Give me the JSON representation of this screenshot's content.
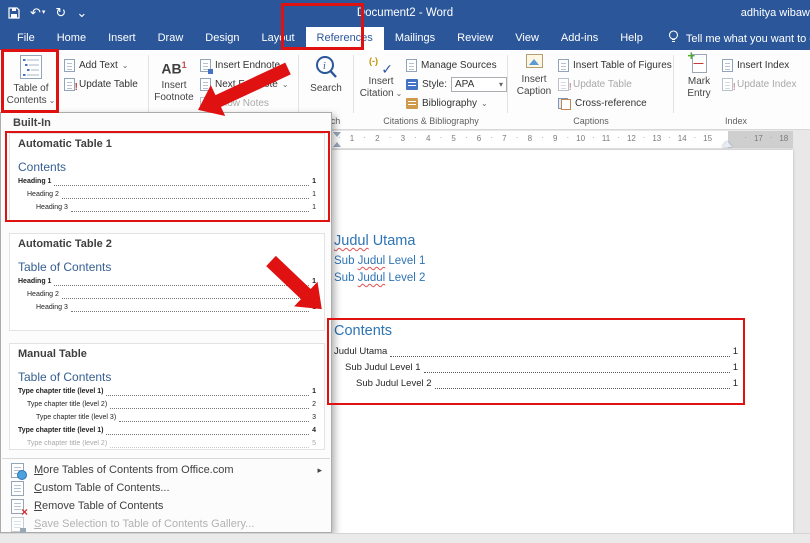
{
  "colors": {
    "titlebar_blue": "#2b579a",
    "annotation_red": "#e01111",
    "heading_blue": "#2e74b5",
    "toc_title_blue": "#365f91"
  },
  "glyphs": {
    "caret": "⌄",
    "submenu": "▸",
    "undo": "↶",
    "redo": "↻",
    "customize": "⌄"
  },
  "title_bar": {
    "title": "Document2  -  Word",
    "user": "adhitya wibawa"
  },
  "tabs": [
    {
      "label": "File"
    },
    {
      "label": "Home"
    },
    {
      "label": "Insert"
    },
    {
      "label": "Draw"
    },
    {
      "label": "Design"
    },
    {
      "label": "Layout"
    },
    {
      "label": "References",
      "selected": true
    },
    {
      "label": "Mailings"
    },
    {
      "label": "Review"
    },
    {
      "label": "View"
    },
    {
      "label": "Add-ins"
    },
    {
      "label": "Help"
    }
  ],
  "tell_me": "Tell me what you want to do",
  "ribbon": {
    "table_of_contents": {
      "line1": "Table of",
      "line2": "Contents"
    },
    "add_text": "Add Text",
    "update_table": "Update Table",
    "footnotes": {
      "ab": "AB",
      "sup": "1",
      "insert": "Insert",
      "footnote": "Footnote",
      "insert_endnote": "Insert Endnote",
      "next_footnote": "Next Footnote",
      "show_notes": "Show Notes"
    },
    "search": "Search",
    "citations": {
      "insert": "Insert",
      "citation": "Citation",
      "manage_sources": "Manage Sources",
      "style_label": "Style:",
      "style_value": "APA",
      "bibliography": "Bibliography"
    },
    "captions": {
      "insert": "Insert",
      "caption": "Caption",
      "insert_table_of_figures": "Insert Table of Figures",
      "update_table": "Update Table",
      "cross_reference": "Cross-reference"
    },
    "index": {
      "mark": "Mark",
      "entry": "Entry",
      "insert_index": "Insert Index",
      "update_index": "Update Index"
    },
    "group_labels": {
      "search": "Search",
      "citations": "Citations & Bibliography",
      "captions": "Captions",
      "index": "Index"
    }
  },
  "dropdown": {
    "header": "Built-In",
    "galleries": [
      {
        "title": "Automatic Table 1",
        "toc_title": "Contents",
        "entries": [
          {
            "text": "Heading 1",
            "page": "1",
            "level": 0,
            "bold": true
          },
          {
            "text": "Heading 2",
            "page": "1",
            "level": 1
          },
          {
            "text": "Heading 3",
            "page": "1",
            "level": 2
          }
        ]
      },
      {
        "title": "Automatic Table 2",
        "toc_title": "Table of Contents",
        "entries": [
          {
            "text": "Heading 1",
            "page": "1",
            "level": 0,
            "bold": true
          },
          {
            "text": "Heading 2",
            "page": "1",
            "level": 1
          },
          {
            "text": "Heading 3",
            "page": "1",
            "level": 2
          }
        ]
      },
      {
        "title": "Manual Table",
        "toc_title": "Table of Contents",
        "entries": [
          {
            "text": "Type chapter title (level 1)",
            "page": "1",
            "level": 0,
            "bold": true
          },
          {
            "text": "Type chapter title (level 2)",
            "page": "2",
            "level": 1
          },
          {
            "text": "Type chapter title (level 3)",
            "page": "3",
            "level": 2
          },
          {
            "text": "Type chapter title (level 1)",
            "page": "4",
            "level": 0,
            "bold": true
          },
          {
            "text": "Type chapter title (level 2)",
            "page": "5",
            "level": 1,
            "faded": true
          }
        ]
      }
    ],
    "menu": [
      {
        "label": "More Tables of Contents from Office.com",
        "icon": "office-com-icon",
        "submenu": true,
        "accel": true
      },
      {
        "label": "Custom Table of Contents...",
        "icon": "custom-toc-icon",
        "accel": true
      },
      {
        "label": "Remove Table of Contents",
        "icon": "remove-toc-icon",
        "accel": true
      },
      {
        "label": "Save Selection to Table of Contents Gallery...",
        "icon": "save-gallery-icon",
        "disabled": true,
        "accel": true
      }
    ]
  },
  "document": {
    "ruler_numbers": [
      "1",
      "2",
      "3",
      "4",
      "5",
      "6",
      "7",
      "8",
      "9",
      "10",
      "11",
      "12",
      "13",
      "14",
      "15",
      "17",
      "18"
    ],
    "headings": [
      {
        "pre": "",
        "bad": "Judul",
        "post": " Utama",
        "level": 0
      },
      {
        "pre": "Sub ",
        "bad": "Judul",
        "post": " Level 1",
        "level": 1
      },
      {
        "pre": "Sub ",
        "bad": "Judul",
        "post": " Level 2",
        "level": 1
      }
    ],
    "toc": {
      "title": "Contents",
      "entries": [
        {
          "text": "Judul Utama",
          "page": "1",
          "level": 0
        },
        {
          "text": "Sub Judul Level 1",
          "page": "1",
          "level": 1
        },
        {
          "text": "Sub Judul Level 2",
          "page": "1",
          "level": 2
        }
      ]
    }
  }
}
